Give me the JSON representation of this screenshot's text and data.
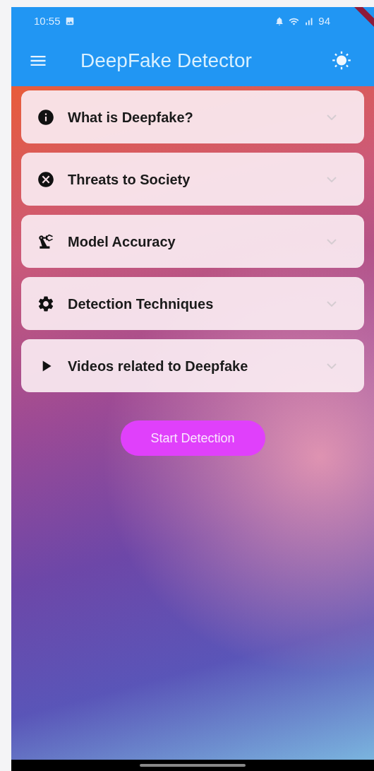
{
  "status_bar": {
    "time": "10:55",
    "battery": "94"
  },
  "app_bar": {
    "title": "DeepFake Detector"
  },
  "sections": [
    {
      "title": "What is Deepfake?",
      "expanded": false
    },
    {
      "title": "Threats to Society",
      "expanded": false
    },
    {
      "title": "Model Accuracy",
      "expanded": false
    },
    {
      "title": "Detection Techniques",
      "expanded": false
    },
    {
      "title": "Videos related to Deepfake",
      "expanded": false
    }
  ],
  "action_button": {
    "label": "Start Detection"
  }
}
